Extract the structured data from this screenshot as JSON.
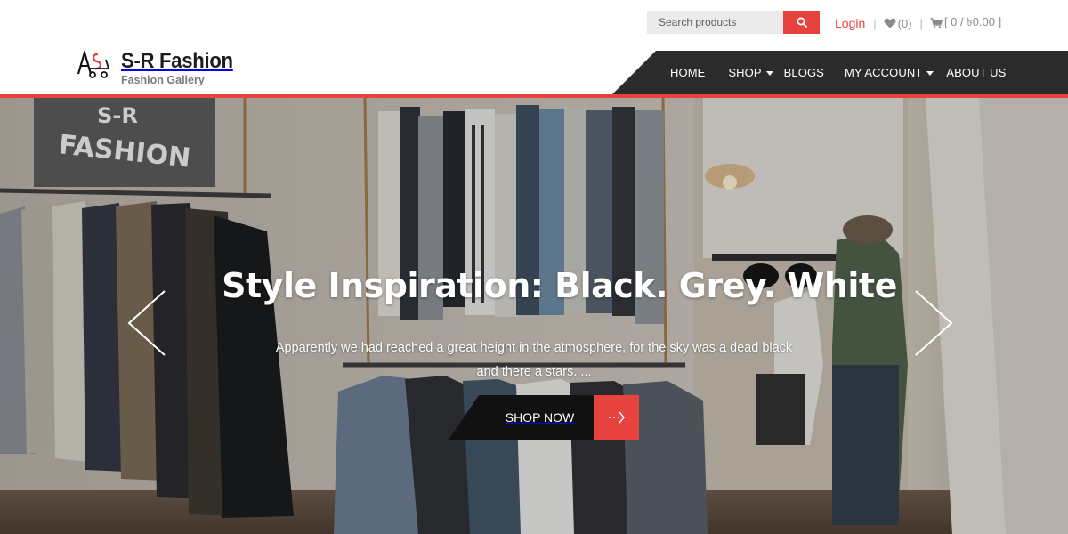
{
  "topbar": {
    "search": {
      "placeholder": "Search products",
      "value": ""
    },
    "search_icon": "search-icon",
    "login_label": "Login",
    "separator": "|",
    "wishlist": {
      "icon": "heart-icon",
      "count_label": "(0)"
    },
    "cart": {
      "icon": "cart-icon",
      "label": "[ 0 / ৳0.00 ]"
    }
  },
  "brand": {
    "logo_icon": "s-r-fashion-logo",
    "title": "S-R Fashion",
    "tagline": "Fashion Gallery"
  },
  "nav": {
    "items": [
      {
        "label": "HOME",
        "has_dropdown": false
      },
      {
        "label": "SHOP",
        "has_dropdown": true
      },
      {
        "label": "BLOGS",
        "has_dropdown": false
      },
      {
        "label": "MY ACCOUNT",
        "has_dropdown": true
      },
      {
        "label": "ABOUT US",
        "has_dropdown": false
      }
    ]
  },
  "hero": {
    "sign_text_line1": "S-R",
    "sign_text_line2": "FASHION",
    "title": "Style Inspiration: Black. Grey. White",
    "text": "Apparently we had reached a great height in the atmosphere, for the sky was a dead black and there a stars. ...",
    "button_label": "SHOP NOW",
    "button_icon": "arrow-right-icon",
    "prev_icon": "chevron-left-icon",
    "next_icon": "chevron-right-icon"
  },
  "colors": {
    "accent": "#e8423f",
    "nav_bg": "#2b2b2b",
    "dark_button": "#111111"
  }
}
